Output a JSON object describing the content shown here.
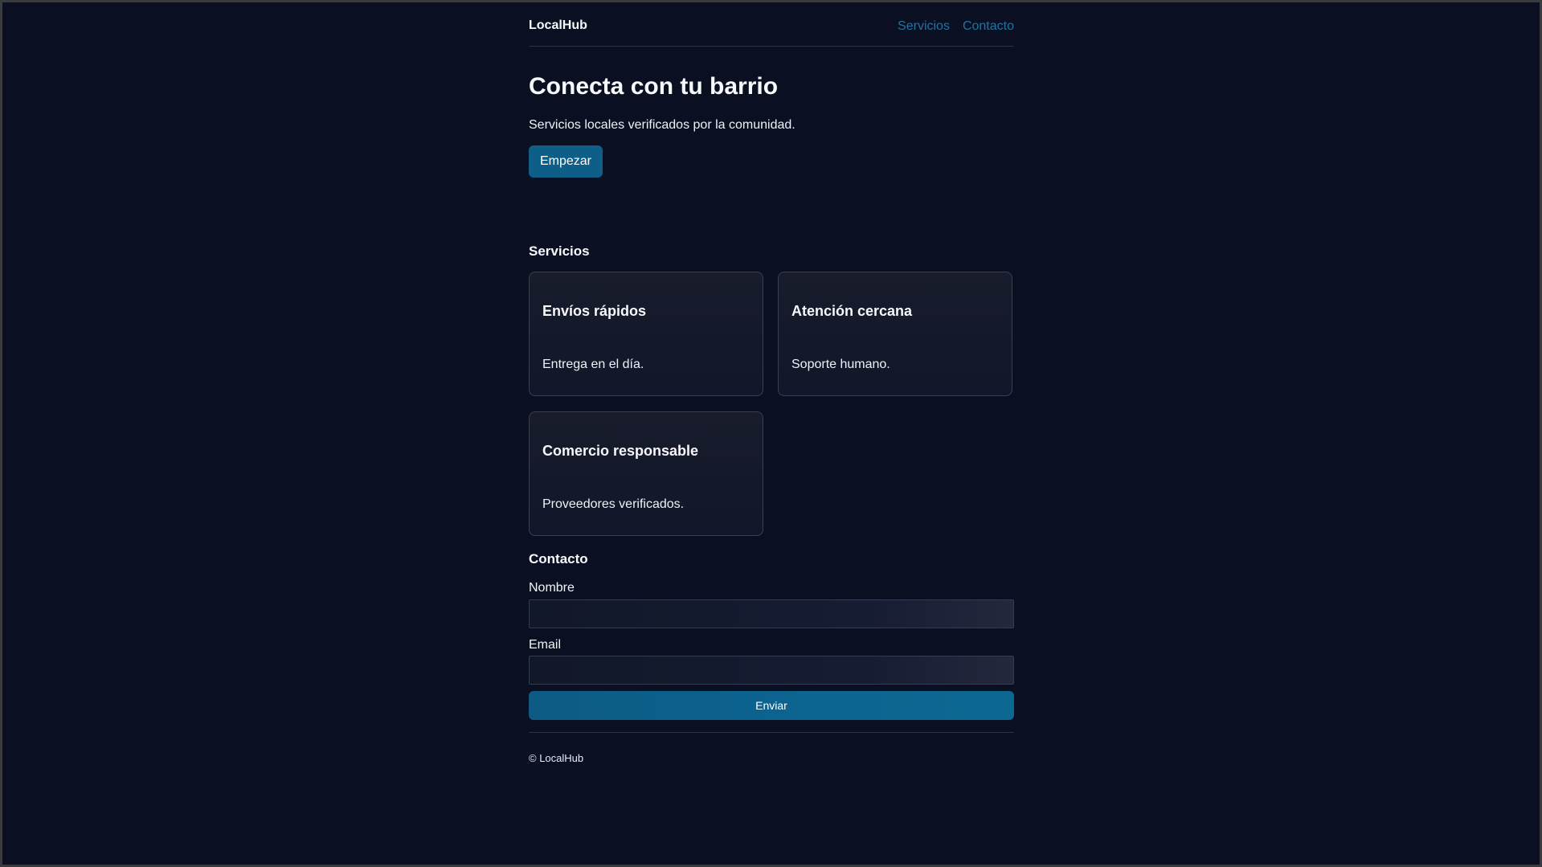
{
  "header": {
    "brand": "LocalHub",
    "nav": [
      {
        "label": "Servicios"
      },
      {
        "label": "Contacto"
      }
    ]
  },
  "hero": {
    "title": "Conecta con tu barrio",
    "subtitle": "Servicios locales verificados por la comunidad.",
    "cta_label": "Empezar"
  },
  "services": {
    "title": "Servicios",
    "items": [
      {
        "title": "Envíos rápidos",
        "description": "Entrega en el día."
      },
      {
        "title": "Atención cercana",
        "description": "Soporte humano."
      },
      {
        "title": "Comercio responsable",
        "description": "Proveedores verificados."
      }
    ]
  },
  "contact": {
    "title": "Contacto",
    "name_label": "Nombre",
    "name_value": "",
    "email_label": "Email",
    "email_value": "",
    "submit_label": "Enviar"
  },
  "footer": {
    "text": "© LocalHub"
  },
  "colors": {
    "background": "#0a1022",
    "accent": "#0e5f87",
    "link": "#1f74a1"
  }
}
